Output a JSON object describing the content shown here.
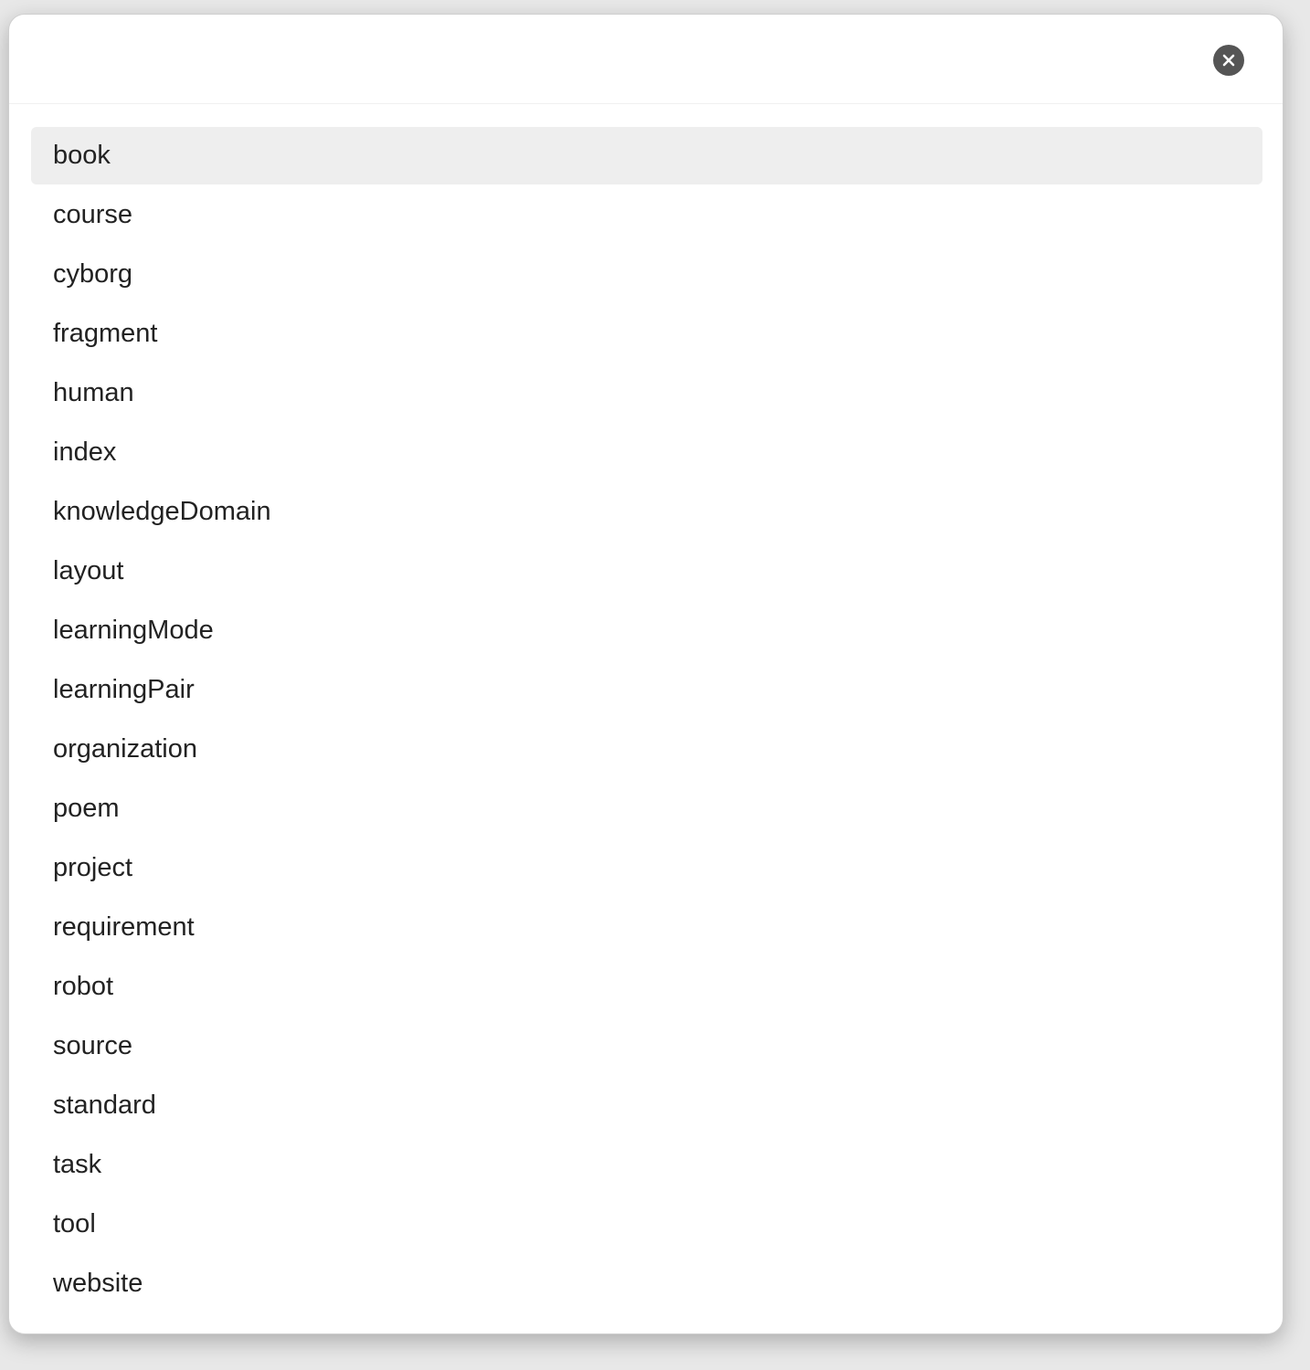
{
  "dialog": {
    "close_icon": "close-icon",
    "highlighted_index": 0,
    "colors": {
      "highlight": "#eeeeee",
      "close_button": "#555555",
      "text": "#222222"
    },
    "options": [
      "book",
      "course",
      "cyborg",
      "fragment",
      "human",
      "index",
      "knowledgeDomain",
      "layout",
      "learningMode",
      "learningPair",
      "organization",
      "poem",
      "project",
      "requirement",
      "robot",
      "source",
      "standard",
      "task",
      "tool",
      "website"
    ]
  }
}
